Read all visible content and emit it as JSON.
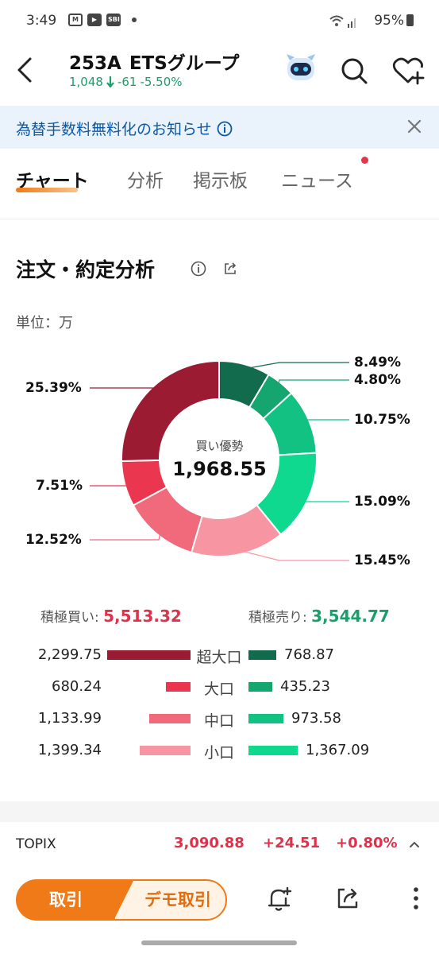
{
  "status_bar": {
    "time": "3:49",
    "icons": [
      "gmail-icon",
      "youtube-icon",
      "sbi-icon"
    ],
    "sbi_text": "SBI",
    "battery": "95%"
  },
  "header": {
    "code": "253A",
    "name": "ETSグループ",
    "price": "1,048",
    "change": "-61",
    "change_pct": "-5.50%"
  },
  "banner": {
    "text": "為替手数料無料化のお知らせ"
  },
  "tabs": [
    {
      "label": "チャート",
      "active": true
    },
    {
      "label": "分析",
      "active": false
    },
    {
      "label": "掲示板",
      "active": false
    },
    {
      "label": "ニュース",
      "active": false,
      "badge": true
    }
  ],
  "section": {
    "title": "注文・約定分析",
    "unit": "単位：万"
  },
  "chart_data": {
    "type": "pie",
    "center_label": "買い優勢",
    "center_value": "1,968.55",
    "slices": [
      {
        "label": "超大口 売り",
        "value": 8.49,
        "text": "8.49%",
        "color": "#136b4d"
      },
      {
        "label": "大口 売り",
        "value": 4.8,
        "text": "4.80%",
        "color": "#15a66f"
      },
      {
        "label": "中口 売り",
        "value": 10.75,
        "text": "10.75%",
        "color": "#12c283"
      },
      {
        "label": "小口 売り",
        "value": 15.09,
        "text": "15.09%",
        "color": "#0ed98f"
      },
      {
        "label": "小口 買い",
        "value": 15.45,
        "text": "15.45%",
        "color": "#f795a2"
      },
      {
        "label": "中口 買い",
        "value": 12.52,
        "text": "12.52%",
        "color": "#f06a7c"
      },
      {
        "label": "大口 買い",
        "value": 7.51,
        "text": "7.51%",
        "color": "#eb3650"
      },
      {
        "label": "超大口 買い",
        "value": 25.39,
        "text": "25.39%",
        "color": "#9a1b32"
      }
    ]
  },
  "totals": {
    "buy_label": "積極買い:",
    "buy_value": "5,513.32",
    "sell_label": "積極売り:",
    "sell_value": "3,544.77"
  },
  "rows": [
    {
      "category": "超大口",
      "buy": "2,299.75",
      "buy_value": 2299.75,
      "sell": "768.87",
      "sell_value": 768.87,
      "buy_color": "#9a1b32",
      "sell_color": "#136b4d"
    },
    {
      "category": "大口",
      "buy": "680.24",
      "buy_value": 680.24,
      "sell": "435.23",
      "sell_value": 435.23,
      "buy_color": "#eb3650",
      "sell_color": "#15a66f"
    },
    {
      "category": "中口",
      "buy": "1,133.99",
      "buy_value": 1133.99,
      "sell": "973.58",
      "sell_value": 973.58,
      "buy_color": "#f06a7c",
      "sell_color": "#12c283"
    },
    {
      "category": "小口",
      "buy": "1,399.34",
      "buy_value": 1399.34,
      "sell": "1,367.09",
      "sell_value": 1367.09,
      "buy_color": "#f795a2",
      "sell_color": "#0ed98f"
    }
  ],
  "index": {
    "name": "TOPIX",
    "value": "3,090.88",
    "change": "+24.51",
    "change_pct": "+0.80%"
  },
  "bottom": {
    "trade_label": "取引",
    "demo_label": "デモ取引"
  }
}
